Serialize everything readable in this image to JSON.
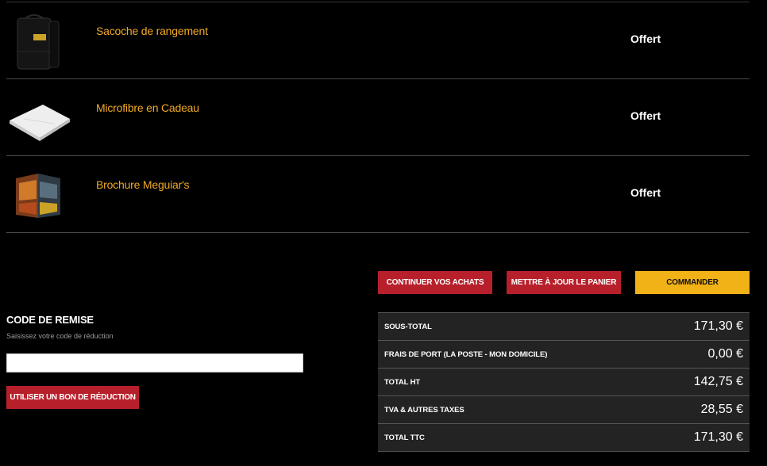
{
  "cart": {
    "items": [
      {
        "name": "Sacoche de rangement",
        "price": "Offert",
        "icon": "storage-bag-icon"
      },
      {
        "name": "Microfibre en Cadeau",
        "price": "Offert",
        "icon": "microfiber-cloth-icon"
      },
      {
        "name": "Brochure Meguiar's",
        "price": "Offert",
        "icon": "brochure-icon"
      }
    ]
  },
  "actions": {
    "continue_label": "CONTINUER VOS ACHATS",
    "update_label": "METTRE À JOUR LE PANIER",
    "order_label": "COMMANDER"
  },
  "discount": {
    "title": "CODE DE REMISE",
    "subtitle": "Saisissez votre code de réduction",
    "input_value": "",
    "button_label": "UTILISER UN BON DE RÉDUCTION"
  },
  "totals": [
    {
      "label": "SOUS-TOTAL",
      "value": "171,30 €"
    },
    {
      "label": "FRAIS DE PORT (LA POSTE - MON DOMICILE)",
      "value": "0,00 €"
    },
    {
      "label": "TOTAL HT",
      "value": "142,75 €"
    },
    {
      "label": "TVA & AUTRES TAXES",
      "value": "28,55 €"
    },
    {
      "label": "TOTAL TTC",
      "value": "171,30 €"
    }
  ],
  "colors": {
    "accent_red": "#b7202b",
    "accent_yellow": "#f0b217",
    "item_name_orange": "#f0a925",
    "totals_bg": "#232323"
  }
}
